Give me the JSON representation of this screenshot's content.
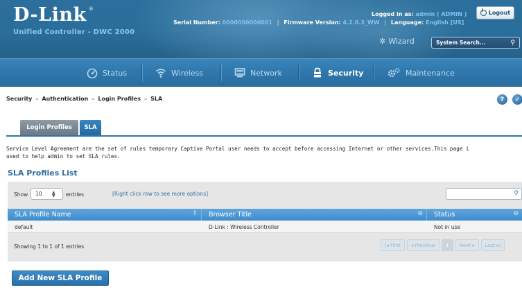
{
  "header": {
    "logo": "D-Link",
    "logo_reg": "®",
    "subtitle": "Unified Controller - DWC 2000",
    "serial_label": "Serial Number:",
    "serial_value": "0000000000001",
    "firmware_label": "Firmware Version:",
    "firmware_value": "4.2.0.3_WW",
    "language_label": "Language:",
    "language_value": "English [US]",
    "logged_in_label": "Logged in as:",
    "logged_in_value": "admin ( ADMIN )",
    "logout_label": "Logout",
    "wizard_label": "Wizard",
    "search_placeholder": "System Search..."
  },
  "nav": {
    "items": [
      {
        "label": "Status",
        "icon": "gauge-icon"
      },
      {
        "label": "Wireless",
        "icon": "wifi-icon"
      },
      {
        "label": "Network",
        "icon": "network-icon"
      },
      {
        "label": "Security",
        "icon": "lock-icon",
        "active": true
      },
      {
        "label": "Maintenance",
        "icon": "gears-icon"
      }
    ]
  },
  "breadcrumb": [
    "Security",
    "Authentication",
    "Login Profiles",
    "SLA"
  ],
  "tabs": [
    {
      "label": "Login Profiles",
      "active": false
    },
    {
      "label": "SLA",
      "active": true
    }
  ],
  "description": "Service Level Agreement are the set of rules temporary Captive Portal user needs to accept before accessing Internet or other services.This page i\nused to help admin to set SLA rules.",
  "section_title": "SLA Profiles List",
  "table": {
    "show_label": "Show",
    "entries_value": "10",
    "entries_label": "entries",
    "hint": "[Right click row to see more options]",
    "columns": [
      "SLA Profile Name",
      "Browser Title",
      "Status"
    ],
    "rows": [
      [
        "default",
        "D-Link : Wireless Controller",
        "Not in use"
      ]
    ],
    "info": "Showing 1 to 1 of 1 entries",
    "pager": {
      "first": "First",
      "previous": "Previous",
      "page": "1",
      "next": "Next",
      "last": "Last"
    }
  },
  "add_button": "Add New SLA Profile",
  "colors": {
    "header_blue": "#2a6e9b",
    "nav_blue": "#2f77ac",
    "accent_blue": "#2c6fa6",
    "table_header": "#4a95d3"
  }
}
